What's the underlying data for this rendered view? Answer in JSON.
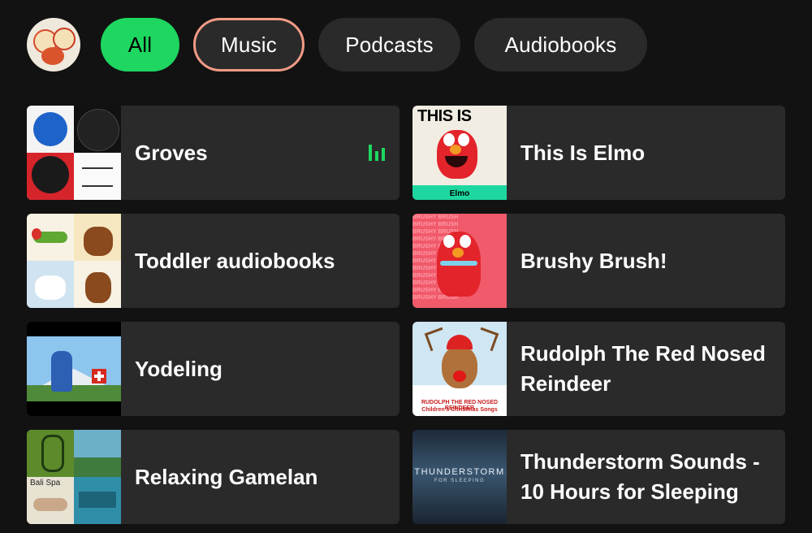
{
  "filters": [
    {
      "label": "All",
      "state": "selected"
    },
    {
      "label": "Music",
      "state": "focused"
    },
    {
      "label": "Podcasts",
      "state": "default"
    },
    {
      "label": "Audiobooks",
      "state": "default"
    }
  ],
  "items": [
    {
      "title": "Groves",
      "now_playing": true
    },
    {
      "title": "This Is Elmo"
    },
    {
      "title": "Toddler audiobooks"
    },
    {
      "title": "Brushy Brush!"
    },
    {
      "title": "Yodeling"
    },
    {
      "title": "Rudolph The Red Nosed Reindeer"
    },
    {
      "title": "Relaxing Gamelan"
    },
    {
      "title": "Thunderstorm Sounds - 10 Hours for Sleeping"
    }
  ],
  "art_text": {
    "this_is": "THIS IS",
    "elmo_caption": "Elmo",
    "brushy_pattern": "BRUSHY BRUSH",
    "rudolph_caption": "RUDOLPH THE RED NOSED REINDEER",
    "rudolph_sub": "Children's Christmas Songs",
    "thunder_title": "THUNDERSTORM",
    "thunder_sub": "FOR SLEEPING",
    "bali_spa": "Bali Spa"
  },
  "colors": {
    "accent": "#1ed760",
    "chip_bg": "#2a2a2a",
    "card_bg": "#2a2a2a",
    "focus_ring": "#f29a86",
    "background": "#121212"
  }
}
